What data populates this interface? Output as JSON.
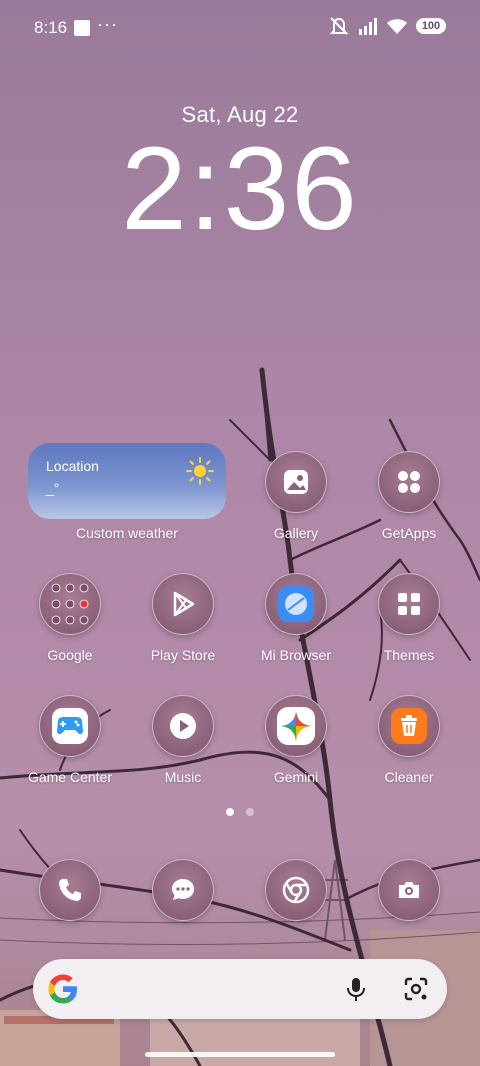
{
  "status_bar": {
    "time": "8:16",
    "battery": "100",
    "icons": [
      "mute-icon",
      "signal-icon",
      "wifi-icon",
      "battery-icon"
    ]
  },
  "lockclock": {
    "date": "Sat, Aug 22",
    "time": "2:36"
  },
  "weather_widget": {
    "location": "Location",
    "temperature": "_°",
    "label": "Custom weather"
  },
  "apps": {
    "gallery": "Gallery",
    "getapps": "GetApps",
    "google": "Google",
    "play_store": "Play Store",
    "mi_browser": "Mi Browser",
    "themes": "Themes",
    "game_center": "Game Center",
    "music": "Music",
    "gemini": "Gemini",
    "cleaner": "Cleaner"
  },
  "dock": [
    "phone-icon",
    "messages-icon",
    "chrome-icon",
    "camera-icon"
  ],
  "pager": {
    "pages": 2,
    "active": 1
  },
  "search_bar": {
    "icons": [
      "google-g-icon",
      "mic-icon",
      "lens-icon"
    ]
  }
}
